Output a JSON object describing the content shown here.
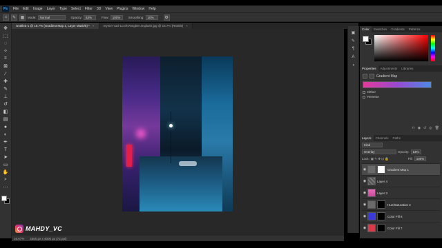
{
  "menubar": {
    "logo": "Ps",
    "items": [
      "File",
      "Edit",
      "Image",
      "Layer",
      "Type",
      "Select",
      "Filter",
      "3D",
      "View",
      "Plugins",
      "Window",
      "Help"
    ]
  },
  "options": {
    "mode_label": "Mode:",
    "mode_value": "Normal",
    "opacity_label": "Opacity:",
    "opacity_value": "63%",
    "flow_label": "Flow:",
    "flow_value": "100%",
    "smoothing_label": "Smoothing:",
    "smoothing_value": "10%"
  },
  "tabs": [
    {
      "label": "Untitled-1 @ 16.7% (Gradient Map 1, Layer Mask/8) *",
      "close": "×"
    },
    {
      "label": "reynier-carl-1c47b78ngb8-unsplash.jpg @ 16.7% (RGB/8)",
      "close": "×"
    }
  ],
  "status": {
    "zoom": "16.67%",
    "doc_size": "2560 px x 4000 px (72 ppi)"
  },
  "color_panel": {
    "tabs": [
      "Color",
      "Swatches",
      "Gradients",
      "Patterns"
    ]
  },
  "properties_panel": {
    "tabs": [
      "Properties",
      "Adjustments",
      "Libraries"
    ],
    "title": "Gradient Map",
    "dither": "Dither",
    "reverse": "Reverse",
    "gradient_colors": [
      "#e23a9a",
      "#9a4ad0",
      "#4a8ae6"
    ]
  },
  "layers_panel": {
    "tabs": [
      "Layers",
      "Channels",
      "Paths"
    ],
    "kind": "Kind",
    "blend_mode": "Overlay",
    "opacity_label": "Opacity:",
    "opacity_value": "13%",
    "lock_label": "Lock:",
    "fill_label": "Fill:",
    "fill_value": "100%",
    "layers": [
      {
        "name": "Gradient Map 1",
        "selected": true
      },
      {
        "name": "Layer 4",
        "selected": false
      },
      {
        "name": "Layer 3",
        "selected": false
      },
      {
        "name": "Hue/Saturation 2",
        "selected": false
      },
      {
        "name": "Color Fill 8",
        "selected": false
      },
      {
        "name": "Color Fill 7",
        "selected": false
      }
    ]
  },
  "watermark": {
    "text": "MAHDY_VC"
  }
}
